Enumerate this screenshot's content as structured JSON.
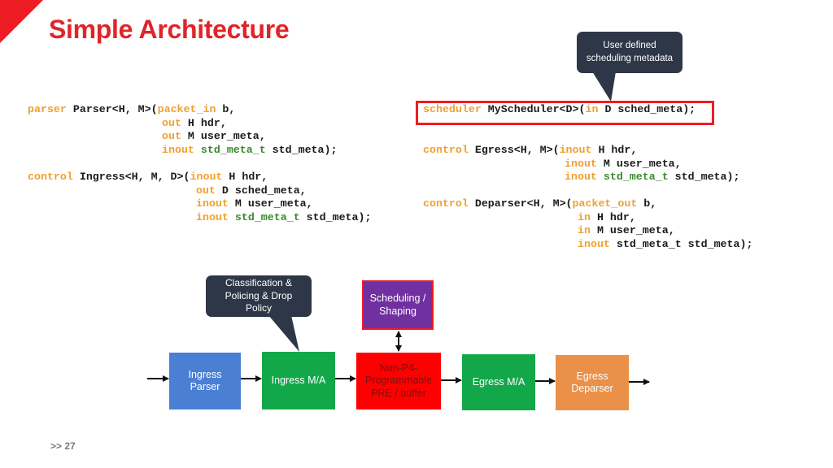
{
  "slide": {
    "title": "Simple Architecture",
    "page_marker": ">>",
    "page_number": "27"
  },
  "callouts": {
    "scheduling_metadata": "User defined scheduling metadata",
    "classification": "Classification & Policing & Drop Policy"
  },
  "code": {
    "parser": {
      "l1_kw": "parser",
      "l1_a": " Parser<H, M>(",
      "l1_kw2": "packet_in",
      "l1_b": " b,",
      "l2_kw": "out",
      "l2_a": " H hdr,",
      "l3_kw": "out",
      "l3_a": " M user_meta,",
      "l4_kw": "inout",
      "l4_ty": "std_meta_t",
      "l4_a": " std_meta);"
    },
    "ingress": {
      "l1_kw": "control",
      "l1_a": " Ingress<H, M, D>(",
      "l1_kw2": "inout",
      "l1_b": " H hdr,",
      "l2_kw": "out",
      "l2_a": " D sched_meta,",
      "l3_kw": "inout",
      "l3_a": " M user_meta,",
      "l4_kw": "inout",
      "l4_ty": "std_meta_t",
      "l4_a": " std_meta);"
    },
    "scheduler": {
      "l1_kw": "scheduler",
      "l1_a": " MyScheduler<D>(",
      "l1_kw2": "in",
      "l1_b": " D sched_meta);"
    },
    "egress": {
      "l1_kw": "control",
      "l1_a": " Egress<H, M>(",
      "l1_kw2": "inout",
      "l1_b": " H hdr,",
      "l2_kw": "inout",
      "l2_a": " M user_meta,",
      "l3_kw": "inout",
      "l3_ty": "std_meta_t",
      "l3_a": " std_meta);"
    },
    "deparser": {
      "l1_kw": "control",
      "l1_a": " Deparser<H, M>(",
      "l1_kw2": "packet_out",
      "l1_b": " b,",
      "l2_kw": "in",
      "l2_a": " H hdr,",
      "l3_kw": "in",
      "l3_a": " M user_meta,",
      "l4_kw": "inout",
      "l4_a": " std_meta_t std_meta);"
    }
  },
  "diagram": {
    "blocks": [
      {
        "id": "ingress-parser",
        "label": "Ingress Parser",
        "color": "#4a7fd4"
      },
      {
        "id": "ingress-ma",
        "label": "Ingress M/A",
        "color": "#12a84a"
      },
      {
        "id": "pre-buffer",
        "label": "Non-P4-Programmable PRE / buffer",
        "color": "#ff0000"
      },
      {
        "id": "egress-ma",
        "label": "Egress M/A",
        "color": "#12a84a"
      },
      {
        "id": "egress-deparser",
        "label": "Egress Deparser",
        "color": "#ea9048"
      },
      {
        "id": "scheduling-shaping",
        "label": "Scheduling / Shaping",
        "color": "#7030a0"
      }
    ]
  },
  "colors": {
    "accent_red": "#ee1c24",
    "keyword": "#f0a030",
    "type": "#3a8a2e",
    "callout_bg": "#2e3748"
  }
}
